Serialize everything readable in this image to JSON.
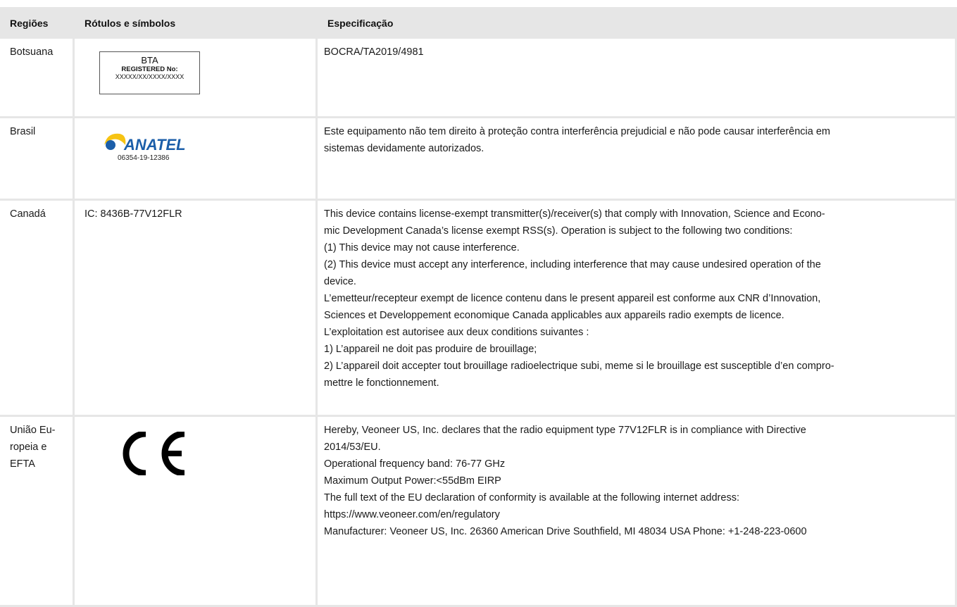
{
  "header": {
    "col_region": "Regiões",
    "col_labels": "Rótulos e símbolos",
    "col_spec": "Especificação"
  },
  "rows": [
    {
      "region": [
        "Botsuana"
      ],
      "label": {
        "type": "bta-badge",
        "line1": "BTA",
        "line2": "REGISTERED No:",
        "line3": "XXXXX/XX/XXXX/XXXX"
      },
      "spec": [
        "BOCRA/TA2019/4981"
      ]
    },
    {
      "region": [
        "Brasil"
      ],
      "label": {
        "type": "anatel-logo",
        "brand": "ANATEL",
        "number": "06354-19-12386",
        "colors": {
          "blue": "#1b5ea9",
          "yellow": "#f6c313"
        }
      },
      "spec": [
        "Este equipamento não tem direito à proteção contra interferência prejudicial e não pode causar interferência em",
        "sistemas devidamente autorizados."
      ]
    },
    {
      "region": [
        "Canadá"
      ],
      "label": {
        "type": "text",
        "text": "IC: 8436B-77V12FLR"
      },
      "spec": [
        "This device contains license-exempt transmitter(s)/receiver(s) that comply with Innovation, Science and Econo-",
        "mic Development Canada’s license exempt RSS(s). Operation is subject to the following two conditions:",
        "(1) This device may not cause interference.",
        "(2) This device must accept any interference, including interference that may cause undesired operation of the",
        "device.",
        "L’emetteur/recepteur exempt de licence contenu dans le present appareil est conforme aux CNR d’Innovation,",
        "Sciences et Developpement economique Canada applicables aux appareils radio exempts de licence.",
        "L’exploitation est autorisee aux deux conditions suivantes :",
        "1) L’appareil ne doit pas produire de brouillage;",
        "2) L’appareil doit accepter tout brouillage radioelectrique subi, meme si le brouillage est susceptible d’en compro-",
        "mettre le fonctionnement."
      ]
    },
    {
      "region": [
        "União Eu-",
        "ropeia e",
        "EFTA"
      ],
      "label": {
        "type": "ce-mark",
        "icon": "ce-mark-icon"
      },
      "spec": [
        "Hereby, Veoneer US, Inc. declares that the radio equipment type 77V12FLR is in compliance with Directive",
        "2014/53/EU.",
        "Operational frequency band: 76-77 GHz",
        "Maximum Output Power:<55dBm EIRP",
        "The full text of the EU declaration of conformity is available at the following internet address:",
        "https://www.veoneer.com/en/regulatory",
        "Manufacturer: Veoneer US, Inc. 26360 American Drive Southfield, MI 48034 USA Phone: +1-248-223-0600"
      ]
    }
  ]
}
